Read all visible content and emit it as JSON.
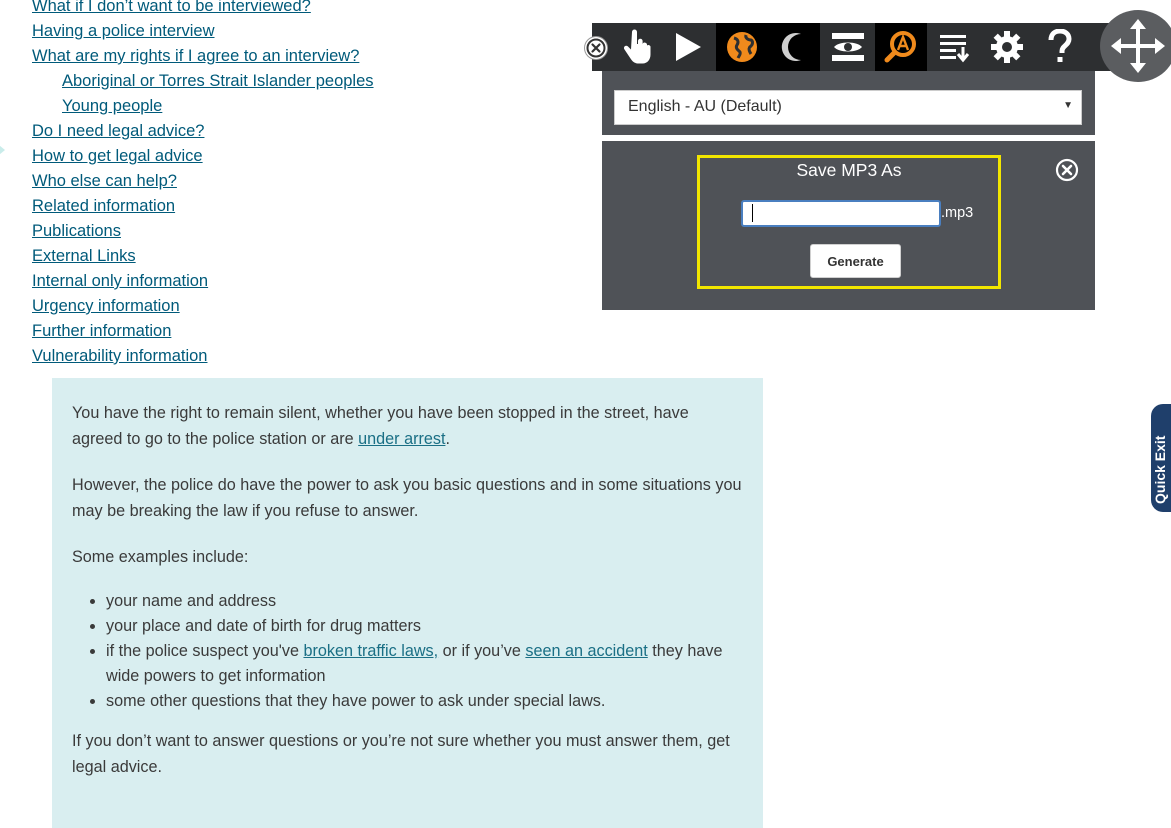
{
  "nav": {
    "links": [
      {
        "label": "What if I don’t want to be interviewed?",
        "sub": false
      },
      {
        "label": "Having a police interview",
        "sub": false
      },
      {
        "label": "What are my rights if I agree to an interview?",
        "sub": false
      },
      {
        "label": "Aboriginal or Torres Strait Islander peoples",
        "sub": true
      },
      {
        "label": "Young people",
        "sub": true
      },
      {
        "label": "Do I need legal advice?",
        "sub": false
      },
      {
        "label": "How to get legal advice",
        "sub": false
      },
      {
        "label": "Who else can help?",
        "sub": false
      },
      {
        "label": "Related information",
        "sub": false
      },
      {
        "label": "Publications",
        "sub": false
      },
      {
        "label": "External Links",
        "sub": false
      },
      {
        "label": "Internal only information",
        "sub": false
      },
      {
        "label": "Urgency information",
        "sub": false
      },
      {
        "label": "Further information",
        "sub": false
      },
      {
        "label": "Vulnerability information",
        "sub": false
      }
    ]
  },
  "content": {
    "p1_text": "You have the right to remain silent, whether you have been stopped in the street, have agreed to go to the police station or are ",
    "p1_link": "under arrest",
    "p1_end": ".",
    "p2": "However, the police do have the power to ask you basic questions and in some situations you may be breaking the law if you refuse to answer.",
    "p3": "Some examples include:",
    "bullet1": "your name and address",
    "bullet2": "your place and date of birth for drug matters",
    "bullet3_a": "if the police suspect you've ",
    "bullet3_link1": "broken traffic laws,",
    "bullet3_b": " or if you’ve ",
    "bullet3_link2": "seen an accident",
    "bullet3_c": " they have wide powers to get information",
    "bullet4": "some other questions that they have power to ask under special laws.",
    "p4": "If you don’t want to answer questions or you’re not sure whether you must answer them, get legal advice."
  },
  "quick_exit": {
    "label": "Quick Exit"
  },
  "toolbar": {
    "language_selected": "English - AU (Default)",
    "save_dialog": {
      "title": "Save MP3 As",
      "filename_value": "",
      "extension": ".mp3",
      "generate_label": "Generate"
    }
  },
  "colors": {
    "link": "#005a7a",
    "info_box_bg": "#d9eef0",
    "toolbar_bg": "#2d2f31",
    "panel_bg": "#4f5257",
    "highlight_frame": "#f2e600",
    "accent_orange": "#f08a1c",
    "quick_exit_bg": "#1f3f6b"
  },
  "icons": [
    "close-icon",
    "hand-pointer-icon",
    "play-icon",
    "translate-globe-icon",
    "screen-mask-icon",
    "eye-icon",
    "magnifier-a-icon",
    "mp3-download-icon",
    "gear-icon",
    "help-icon",
    "move-arrows-icon",
    "dropdown-arrow-icon"
  ]
}
